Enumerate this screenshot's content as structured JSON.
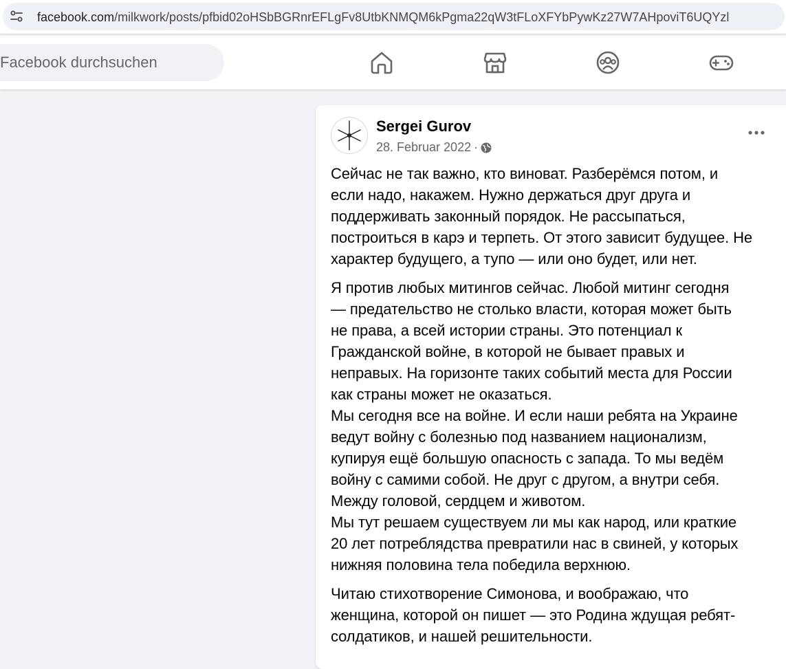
{
  "browser": {
    "url_domain": "facebook.com",
    "url_path": "/milkwork/posts/pfbid02oHSbBGRnrEFLgFv8UtbKNMQM6kPgma22qW3tFLoXFYbPywKz27W7AHpoviT6UQYzl",
    "site_info_icon": "tune-icon"
  },
  "header": {
    "search_placeholder": "Facebook durchsuchen",
    "nav": [
      {
        "icon": "home-icon"
      },
      {
        "icon": "marketplace-icon"
      },
      {
        "icon": "groups-icon"
      },
      {
        "icon": "gaming-icon"
      }
    ]
  },
  "post": {
    "author": "Sergei Gurov",
    "date": "28. Februar 2022",
    "separator": "·",
    "privacy_icon": "globe-icon",
    "more_icon": "more-dots-icon",
    "paragraphs": [
      [
        "Сейчас не так важно, кто виноват. Разберёмся потом, и",
        "если надо, накажем. Нужно держаться друг друга и",
        "поддерживать законный порядок. Не рассыпаться,",
        "построиться в карэ и терпеть. От этого зависит будущее. Не",
        "характер будущего, а тупо — или оно будет, или нет."
      ],
      [
        "Я против любых митингов сейчас. Любой митинг сегодня",
        "— предательство не столько власти, которая может быть",
        "не права, а всей истории страны. Это потенциал к",
        "Гражданской войне, в которой не бывает правых и",
        "неправых. На горизонте таких событий места для России",
        "как страны может не оказаться.",
        "Мы сегодня все на войне. И если наши ребята на Украине",
        "ведут войну с болезнью под названием национализм,",
        "купируя ещё большую опасность с запада. То мы ведём",
        "войну с самими собой. Не друг с другом, а внутри себя.",
        "Между головой, сердцем и животом.",
        "Мы тут решаем существуем ли мы как народ, или краткие",
        "20 лет потреблядства превратили нас в свиней, у которых",
        "нижняя половина тела победила верхнюю."
      ],
      [
        "Читаю стихотворение Симонова, и воображаю, что",
        "женщина, которой он пишет — это Родина ждущая ребят-",
        "солдатиков, и нашей решительности."
      ]
    ]
  },
  "colors": {
    "page_bg": "#f0f2f5",
    "card_bg": "#ffffff",
    "text_primary": "#050505",
    "text_secondary": "#65676b",
    "icon": "#65676b"
  }
}
